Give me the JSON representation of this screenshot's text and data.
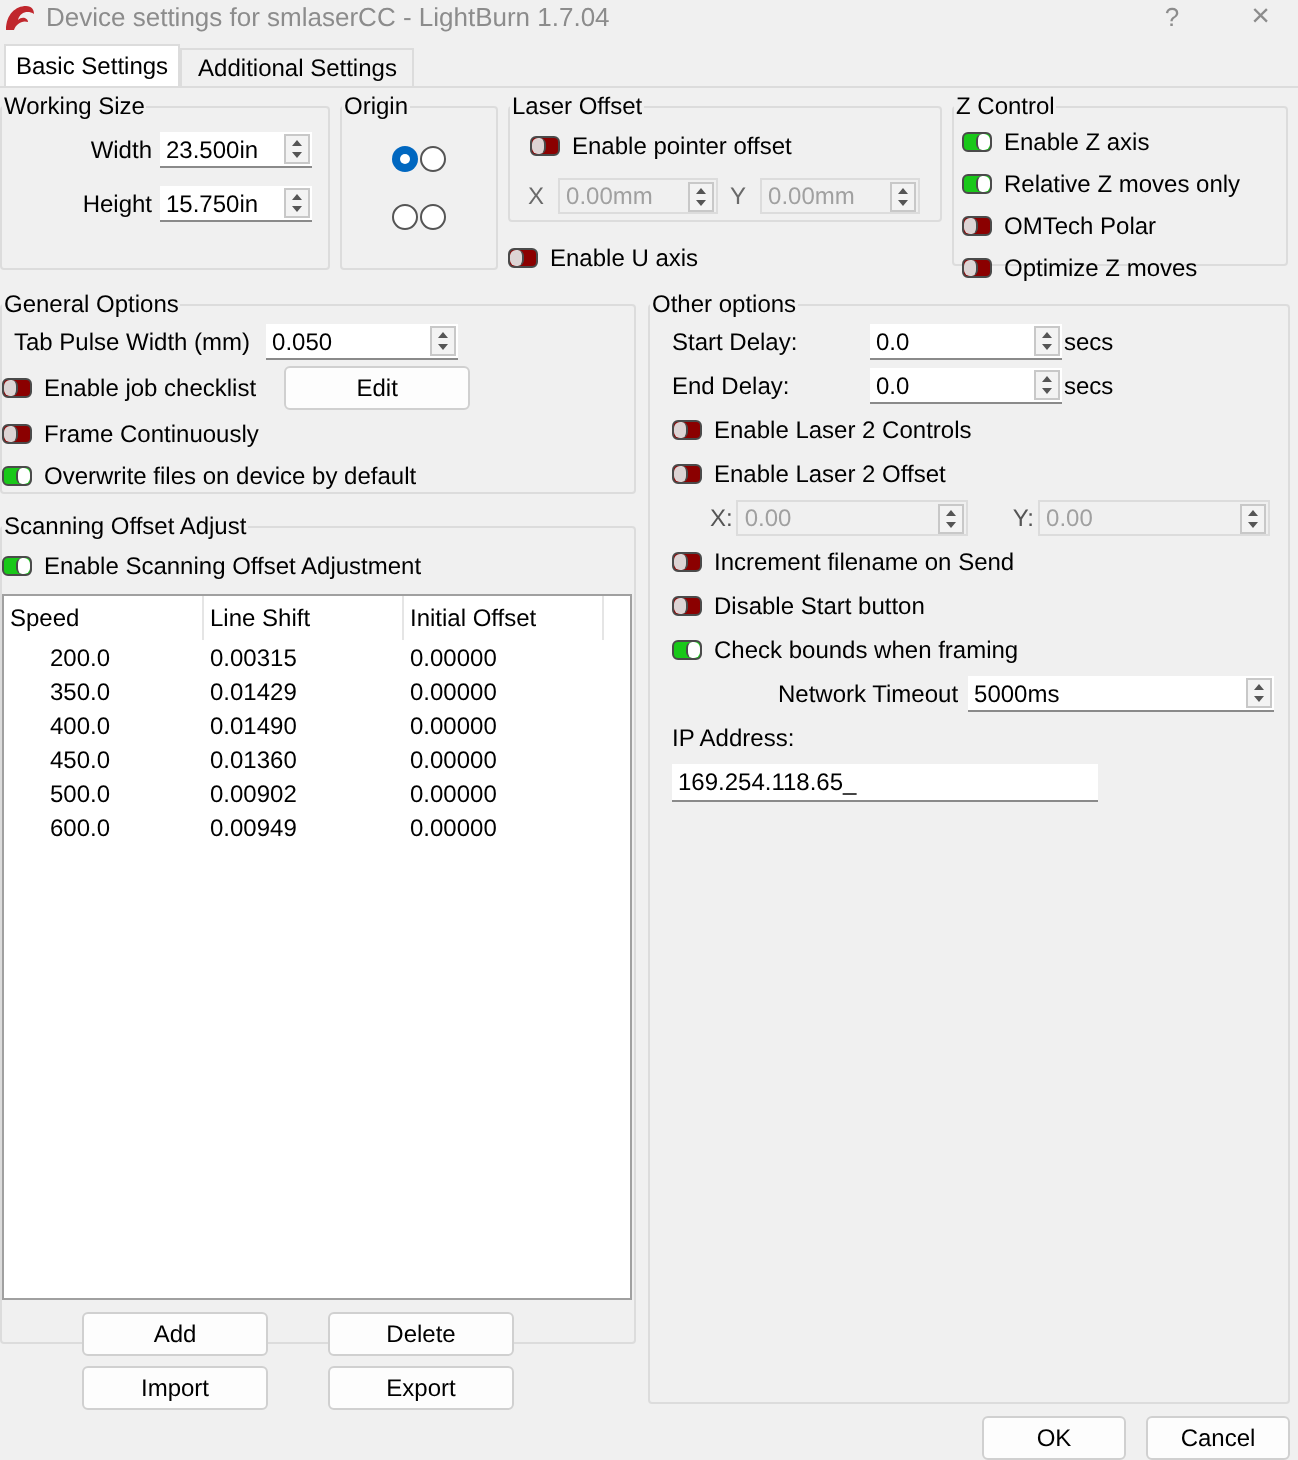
{
  "window": {
    "title": "Device settings for smlaserCC - LightBurn 1.7.04",
    "help": "?",
    "close": "×"
  },
  "tabs": [
    {
      "label": "Basic Settings",
      "selected": true
    },
    {
      "label": "Additional Settings",
      "selected": false
    }
  ],
  "working_size": {
    "title": "Working Size",
    "fields": [
      {
        "label": "Width",
        "value": "23.500in"
      },
      {
        "label": "Height",
        "value": "15.750in"
      }
    ]
  },
  "origin": {
    "title": "Origin",
    "options": [
      {
        "selected": true
      },
      {
        "selected": false
      },
      {
        "selected": false
      },
      {
        "selected": false
      }
    ]
  },
  "laser_offset": {
    "title": "Laser Offset",
    "toggle": {
      "label": "Enable pointer offset",
      "on": false
    },
    "fields": [
      {
        "label": "X",
        "value": "0.00mm",
        "disabled": true
      },
      {
        "label": "Y",
        "value": "0.00mm",
        "disabled": true
      }
    ]
  },
  "u_axis": {
    "label": "Enable U axis",
    "on": false
  },
  "z_control": {
    "title": "Z Control",
    "toggles": [
      {
        "label": "Enable Z axis",
        "on": true
      },
      {
        "label": "Relative Z moves only",
        "on": true
      },
      {
        "label": "OMTech Polar",
        "on": false
      },
      {
        "label": "Optimize Z moves",
        "on": false
      }
    ]
  },
  "general_options": {
    "title": "General Options",
    "tab_pulse": {
      "label": "Tab Pulse Width (mm)",
      "value": "0.050"
    },
    "items": [
      {
        "label": "Enable job checklist",
        "on": false,
        "button": "Edit"
      },
      {
        "label": "Frame Continuously",
        "on": false
      },
      {
        "label": "Overwrite files on device by default",
        "on": true
      }
    ]
  },
  "scanning": {
    "title": "Scanning Offset Adjust",
    "toggle": {
      "label": "Enable Scanning Offset Adjustment",
      "on": true
    },
    "table": {
      "columns": [
        "Speed",
        "Line Shift",
        "Initial Offset"
      ],
      "rows": [
        [
          "200.0",
          "0.00315",
          "0.00000"
        ],
        [
          "350.0",
          "0.01429",
          "0.00000"
        ],
        [
          "400.0",
          "0.01490",
          "0.00000"
        ],
        [
          "450.0",
          "0.01360",
          "0.00000"
        ],
        [
          "500.0",
          "0.00902",
          "0.00000"
        ],
        [
          "600.0",
          "0.00949",
          "0.00000"
        ]
      ]
    },
    "buttons": [
      "Add",
      "Delete",
      "Import",
      "Export"
    ]
  },
  "other_options": {
    "title": "Other options",
    "items": [
      {
        "kind": "spin",
        "label": "Start Delay:",
        "value": "0.0",
        "unit": "secs"
      },
      {
        "kind": "spin",
        "label": "End Delay:",
        "value": "0.0",
        "unit": "secs"
      },
      {
        "kind": "toggle",
        "label": "Enable Laser 2 Controls",
        "on": false
      },
      {
        "kind": "toggle",
        "label": "Enable Laser 2 Offset",
        "on": false
      },
      {
        "kind": "pair",
        "fields": [
          {
            "label": "X:",
            "value": "0.00",
            "disabled": true
          },
          {
            "label": "Y:",
            "value": "0.00",
            "disabled": true
          }
        ]
      },
      {
        "kind": "toggle",
        "label": "Increment filename on Send",
        "on": false
      },
      {
        "kind": "toggle",
        "label": "Disable Start button",
        "on": false
      },
      {
        "kind": "toggle",
        "label": "Check bounds when framing",
        "on": true
      },
      {
        "kind": "timeout",
        "label": "Network Timeout",
        "value": "5000ms"
      },
      {
        "kind": "ip",
        "label": "IP Address:",
        "value": "169.254.118.65_"
      }
    ]
  },
  "footer_buttons": [
    "OK",
    "Cancel"
  ]
}
